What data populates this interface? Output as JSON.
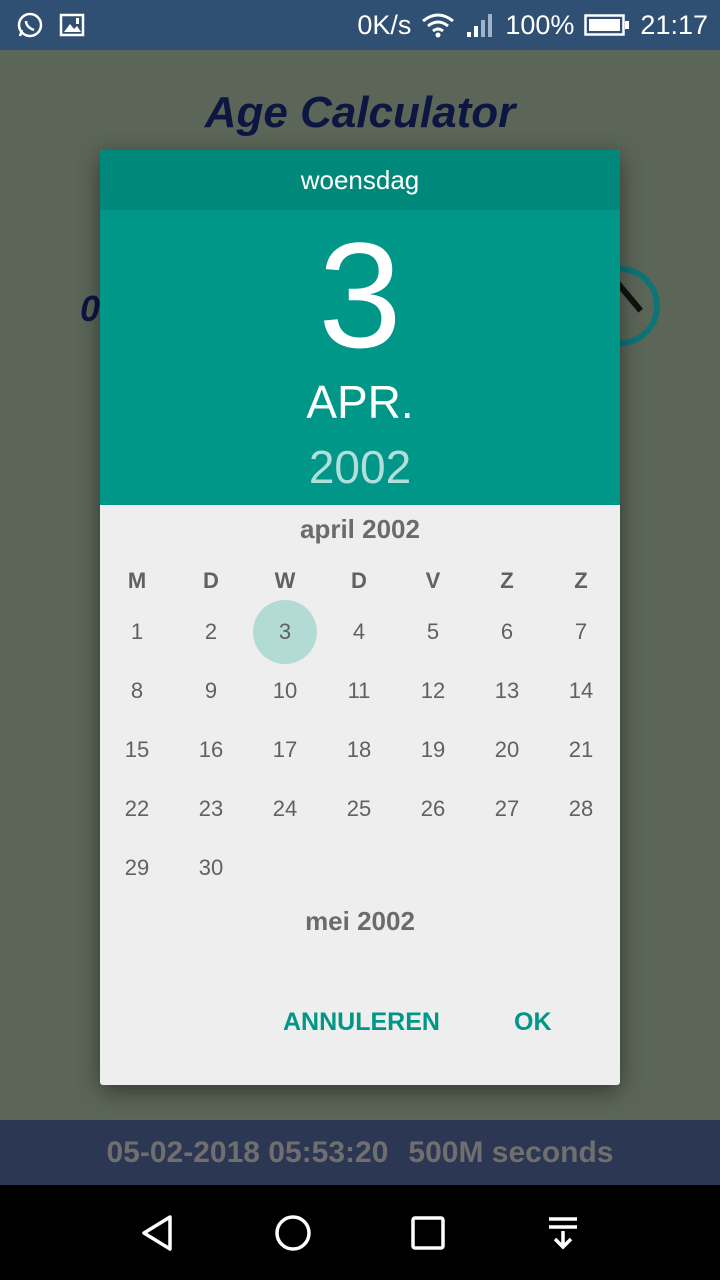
{
  "status_bar": {
    "net_speed": "0K/s",
    "battery": "100%",
    "time": "21:17"
  },
  "app": {
    "title": "Age Calculator",
    "date_partial": "0",
    "bottom_bar": {
      "datetime": "05-02-2018 05:53:20",
      "milestone": "500M seconds"
    }
  },
  "dialog": {
    "day_name": "woensdag",
    "day": "3",
    "month": "APR.",
    "year": "2002",
    "calendar_title": "april 2002",
    "weekdays": [
      "M",
      "D",
      "W",
      "D",
      "V",
      "Z",
      "Z"
    ],
    "days": [
      "1",
      "2",
      "3",
      "4",
      "5",
      "6",
      "7",
      "8",
      "9",
      "10",
      "11",
      "12",
      "13",
      "14",
      "15",
      "16",
      "17",
      "18",
      "19",
      "20",
      "21",
      "22",
      "23",
      "24",
      "25",
      "26",
      "27",
      "28",
      "29",
      "30"
    ],
    "selected_day": "3",
    "next_month_title": "mei 2002",
    "cancel_label": "ANNULEREN",
    "ok_label": "OK"
  },
  "colors": {
    "header": "#009688",
    "day_name_bar": "#00897b",
    "selected_circle": "#b2dbd5",
    "button_text": "#009688"
  },
  "icons": [
    "whatsapp-icon",
    "image-alert-icon",
    "wifi-icon",
    "signal-icon",
    "battery-icon",
    "back-icon",
    "home-icon",
    "recents-icon",
    "notification-pull-icon"
  ]
}
